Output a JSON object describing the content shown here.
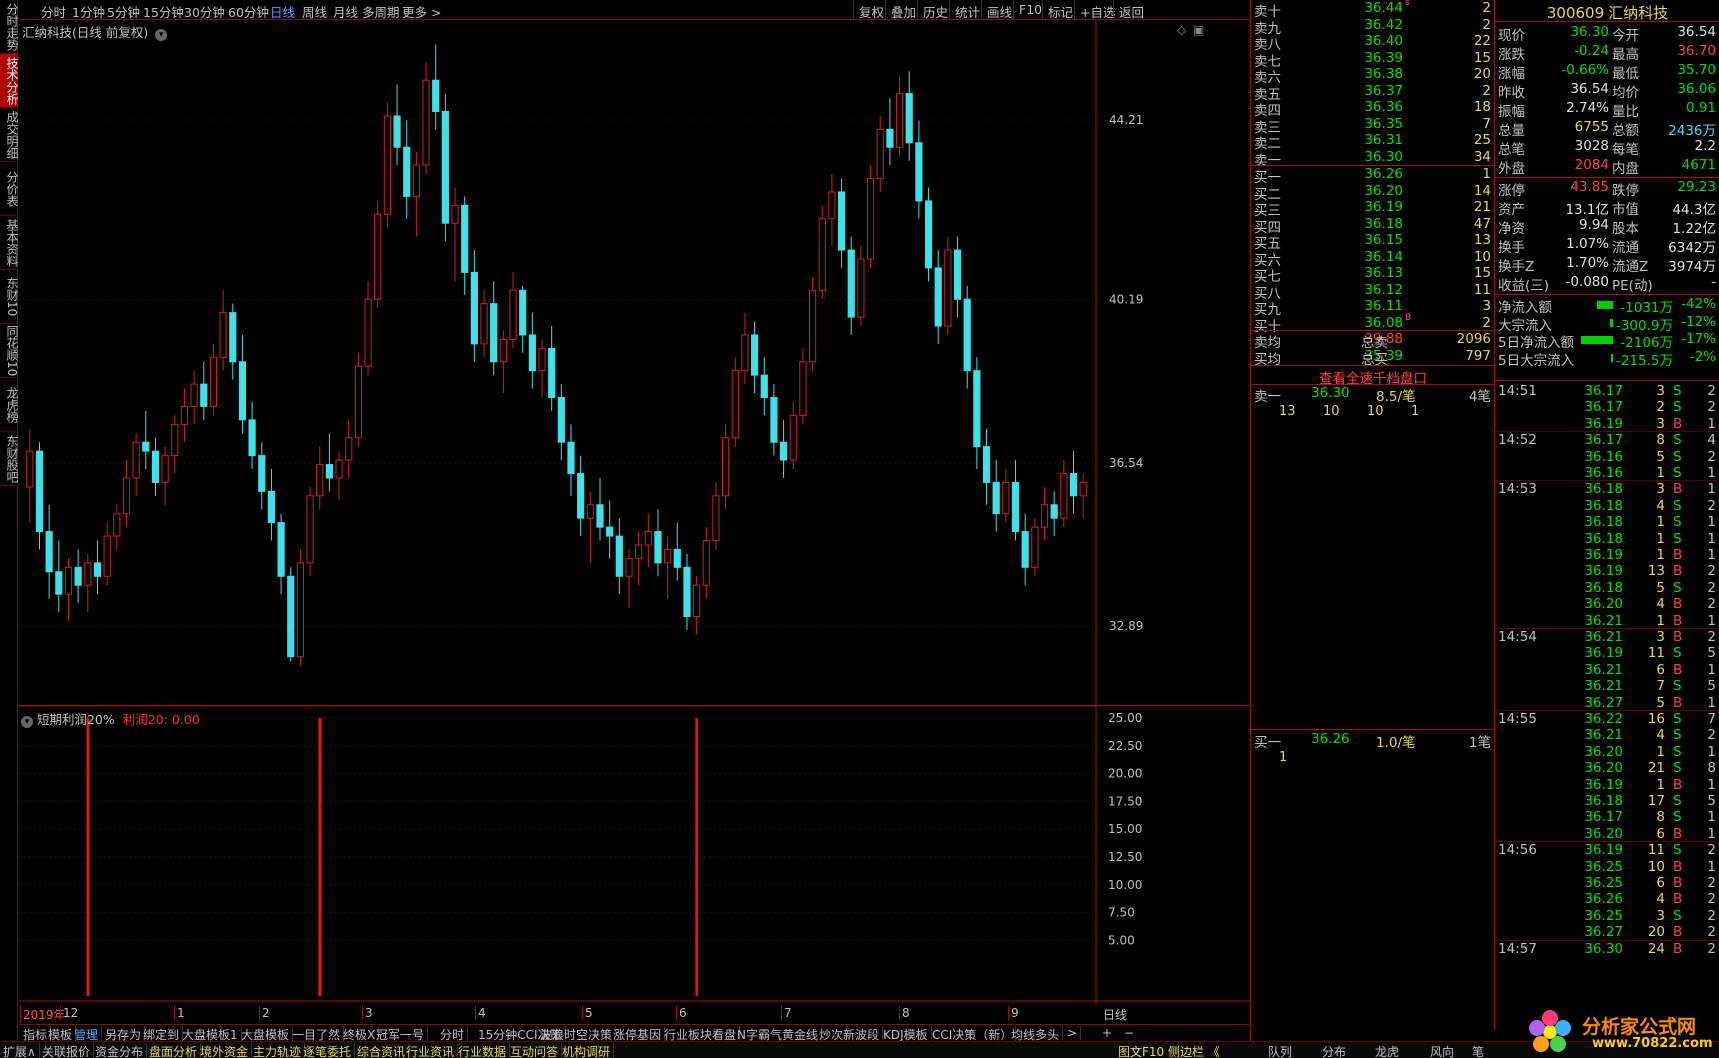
{
  "left_tabs": [
    "分时走势",
    "技术分析",
    "成交明细",
    "分价表",
    "基本资料",
    "东财10",
    "同花顺10",
    "龙虎榜",
    "东财股吧"
  ],
  "left_active": 1,
  "topbar": {
    "periods": [
      "分时",
      "1分钟",
      "5分钟",
      "15分钟",
      "30分钟",
      "60分钟",
      "日线",
      "周线",
      "月线",
      "多周期",
      "更多 >"
    ],
    "active_period": 6,
    "right_tools": [
      "复权",
      "叠加",
      "历史",
      "统计",
      "画线",
      "F10",
      "标记",
      "+自选",
      "返回"
    ]
  },
  "chart": {
    "title": "汇纳科技(日线 前复权)",
    "y_labels": [
      "44.21",
      "40.19",
      "36.54",
      "32.89"
    ],
    "x_labels": [
      "2019年",
      "12",
      "1",
      "2",
      "3",
      "4",
      "5",
      "6",
      "7",
      "8",
      "9"
    ],
    "period_label": "日线",
    "indicator_title": "短期利润20%",
    "indicator_value": "利润20: 0.00",
    "indicator_y_labels": [
      "25.00",
      "22.50",
      "20.00",
      "17.50",
      "15.00",
      "12.50",
      "10.00",
      "7.50",
      "5.00"
    ]
  },
  "chart_data": {
    "type": "candlestick",
    "title": "汇纳科技(日线 前复权)",
    "ylim": [
      31.5,
      46.0
    ],
    "y_ticks": [
      32.89,
      36.54,
      40.19,
      44.21
    ],
    "up_color": "#d02020",
    "down_color": "#40e0e8",
    "candles": [
      [
        36.0,
        37.3,
        35.2,
        36.8
      ],
      [
        36.8,
        37.0,
        34.6,
        35.0
      ],
      [
        35.0,
        35.6,
        33.5,
        34.1
      ],
      [
        34.1,
        34.8,
        33.2,
        33.6
      ],
      [
        33.6,
        34.4,
        33.0,
        34.2
      ],
      [
        34.2,
        34.6,
        33.4,
        33.8
      ],
      [
        33.8,
        34.5,
        33.2,
        34.3
      ],
      [
        34.3,
        34.8,
        33.6,
        34.0
      ],
      [
        34.0,
        35.2,
        33.8,
        34.9
      ],
      [
        34.9,
        35.6,
        34.6,
        35.4
      ],
      [
        35.4,
        36.6,
        35.1,
        36.2
      ],
      [
        36.2,
        37.2,
        35.8,
        37.0
      ],
      [
        37.0,
        37.7,
        36.4,
        36.8
      ],
      [
        36.8,
        37.1,
        35.8,
        36.1
      ],
      [
        36.1,
        36.9,
        35.6,
        36.7
      ],
      [
        36.7,
        37.6,
        36.3,
        37.4
      ],
      [
        37.4,
        38.2,
        37.0,
        37.8
      ],
      [
        37.8,
        38.6,
        37.4,
        38.3
      ],
      [
        38.3,
        38.8,
        37.5,
        37.8
      ],
      [
        37.8,
        39.2,
        37.6,
        38.9
      ],
      [
        38.9,
        40.4,
        38.6,
        39.9
      ],
      [
        39.9,
        40.1,
        38.4,
        38.8
      ],
      [
        38.8,
        39.4,
        37.2,
        37.5
      ],
      [
        37.5,
        37.9,
        36.4,
        36.7
      ],
      [
        36.7,
        37.0,
        35.5,
        35.9
      ],
      [
        35.9,
        36.4,
        34.8,
        35.2
      ],
      [
        35.2,
        35.4,
        33.6,
        34.0
      ],
      [
        34.0,
        34.2,
        32.1,
        32.2
      ],
      [
        32.2,
        34.6,
        32.0,
        34.3
      ],
      [
        34.3,
        36.0,
        34.0,
        35.8
      ],
      [
        35.8,
        36.9,
        35.5,
        36.5
      ],
      [
        36.5,
        37.2,
        35.9,
        36.2
      ],
      [
        36.2,
        36.8,
        35.7,
        36.6
      ],
      [
        36.6,
        37.5,
        36.2,
        37.1
      ],
      [
        37.1,
        39.0,
        36.9,
        38.7
      ],
      [
        38.7,
        40.6,
        38.5,
        40.2
      ],
      [
        40.2,
        42.4,
        40.0,
        42.1
      ],
      [
        42.1,
        44.6,
        41.8,
        44.3
      ],
      [
        44.3,
        45.0,
        43.2,
        43.6
      ],
      [
        43.6,
        44.2,
        42.0,
        42.5
      ],
      [
        42.5,
        43.5,
        41.6,
        43.2
      ],
      [
        43.2,
        45.5,
        43.0,
        45.1
      ],
      [
        45.1,
        45.9,
        44.0,
        44.4
      ],
      [
        44.4,
        44.8,
        41.5,
        41.9
      ],
      [
        41.9,
        42.7,
        40.6,
        42.3
      ],
      [
        42.3,
        42.5,
        40.3,
        40.8
      ],
      [
        40.8,
        41.3,
        38.8,
        39.2
      ],
      [
        39.2,
        40.4,
        38.9,
        40.1
      ],
      [
        40.1,
        40.6,
        38.5,
        38.8
      ],
      [
        38.8,
        39.5,
        38.1,
        39.3
      ],
      [
        39.3,
        40.8,
        39.1,
        40.4
      ],
      [
        40.4,
        40.5,
        39.0,
        39.4
      ],
      [
        39.4,
        39.9,
        38.2,
        38.6
      ],
      [
        38.6,
        39.3,
        38.0,
        39.1
      ],
      [
        39.1,
        39.6,
        37.7,
        38.0
      ],
      [
        38.0,
        38.3,
        36.6,
        37.0
      ],
      [
        37.0,
        37.4,
        35.8,
        36.3
      ],
      [
        36.3,
        36.7,
        34.9,
        35.3
      ],
      [
        35.3,
        35.9,
        34.3,
        35.6
      ],
      [
        35.6,
        36.2,
        34.8,
        35.1
      ],
      [
        35.1,
        35.7,
        34.4,
        34.9
      ],
      [
        34.9,
        35.3,
        33.6,
        34.0
      ],
      [
        34.0,
        34.6,
        33.3,
        34.4
      ],
      [
        34.4,
        35.0,
        33.8,
        34.7
      ],
      [
        34.7,
        35.4,
        34.2,
        35.0
      ],
      [
        35.0,
        35.5,
        34.0,
        34.3
      ],
      [
        34.3,
        34.9,
        33.5,
        34.6
      ],
      [
        34.6,
        35.2,
        33.9,
        34.2
      ],
      [
        34.2,
        34.5,
        32.8,
        33.1
      ],
      [
        33.1,
        34.0,
        32.7,
        33.8
      ],
      [
        33.8,
        35.1,
        33.5,
        34.8
      ],
      [
        34.8,
        36.1,
        34.6,
        35.8
      ],
      [
        35.8,
        37.4,
        35.5,
        37.1
      ],
      [
        37.1,
        38.9,
        36.9,
        38.6
      ],
      [
        38.6,
        39.9,
        38.3,
        39.4
      ],
      [
        39.4,
        39.7,
        38.1,
        38.5
      ],
      [
        38.5,
        38.9,
        37.6,
        38.0
      ],
      [
        38.0,
        38.3,
        36.7,
        37.0
      ],
      [
        37.0,
        37.5,
        36.2,
        36.6
      ],
      [
        36.6,
        37.9,
        36.4,
        37.6
      ],
      [
        37.6,
        39.1,
        37.4,
        38.8
      ],
      [
        38.8,
        40.7,
        38.6,
        40.4
      ],
      [
        40.4,
        42.3,
        40.2,
        42.0
      ],
      [
        42.0,
        43.0,
        41.4,
        42.6
      ],
      [
        42.6,
        42.9,
        40.9,
        41.3
      ],
      [
        41.3,
        41.6,
        39.4,
        39.8
      ],
      [
        39.8,
        41.4,
        39.6,
        41.1
      ],
      [
        41.1,
        43.2,
        40.9,
        42.9
      ],
      [
        42.9,
        44.3,
        42.6,
        44.0
      ],
      [
        44.0,
        44.7,
        43.2,
        43.6
      ],
      [
        43.6,
        45.2,
        43.4,
        44.8
      ],
      [
        44.8,
        45.3,
        43.3,
        43.7
      ],
      [
        43.7,
        44.2,
        42.0,
        42.4
      ],
      [
        42.4,
        42.7,
        40.6,
        40.9
      ],
      [
        40.9,
        41.3,
        39.2,
        39.6
      ],
      [
        39.6,
        41.6,
        39.4,
        41.3
      ],
      [
        41.3,
        41.6,
        39.8,
        40.2
      ],
      [
        40.2,
        40.5,
        38.2,
        38.6
      ],
      [
        38.6,
        38.9,
        36.4,
        36.9
      ],
      [
        36.9,
        37.3,
        35.6,
        36.1
      ],
      [
        36.1,
        36.6,
        35.0,
        35.4
      ],
      [
        35.4,
        36.4,
        35.2,
        36.1
      ],
      [
        36.1,
        36.6,
        34.8,
        35.0
      ],
      [
        35.0,
        35.4,
        33.8,
        34.2
      ],
      [
        34.2,
        35.3,
        34.0,
        35.1
      ],
      [
        35.1,
        36.0,
        34.8,
        35.6
      ],
      [
        35.6,
        35.9,
        34.9,
        35.3
      ],
      [
        35.3,
        36.6,
        35.1,
        36.3
      ],
      [
        36.3,
        36.8,
        35.4,
        35.8
      ],
      [
        35.8,
        36.3,
        35.3,
        36.1
      ]
    ],
    "indicator": {
      "name": "短期利润20%",
      "ylim": [
        0,
        25
      ],
      "y_ticks": [
        5,
        7.5,
        10,
        12.5,
        15,
        17.5,
        20,
        22.5,
        25
      ],
      "signals_at_index": [
        6,
        30,
        69
      ]
    }
  },
  "tabbar1": [
    "指标",
    "模板",
    "管理",
    "另存为",
    "绑定到",
    "大盘模板1",
    "大盘模板",
    "一目了然",
    "终极X",
    "冠军一号",
    "分时",
    "15分钟CCI决策",
    "波浪时空决策",
    "涨停基因",
    "行业板块看盘",
    "N字霸气黄金线",
    "炒次新波段",
    "KDJ模板",
    "CCI决策（新）",
    "均线多头",
    ">"
  ],
  "tabbar1_active": 2,
  "tabbar1_right": [
    "+",
    "−"
  ],
  "tabbar2": [
    "扩展∧",
    "关联报价",
    "资金分布",
    "盘面分析",
    "境外资金",
    "主力轨迹",
    "逐笔委托",
    "综合资讯",
    "行业资讯",
    "行业数据",
    "互动问答",
    "机构调研"
  ],
  "tabbar2_right": "图文F10 侧边栏 《",
  "stock": {
    "code": "300609",
    "name": "汇纳科技"
  },
  "asks": [
    {
      "label": "卖十",
      "price": "36.44",
      "vol": "2",
      "mark": "s"
    },
    {
      "label": "卖九",
      "price": "36.42",
      "vol": "2"
    },
    {
      "label": "卖八",
      "price": "36.40",
      "vol": "22"
    },
    {
      "label": "卖七",
      "price": "36.39",
      "vol": "15"
    },
    {
      "label": "卖六",
      "price": "36.38",
      "vol": "20"
    },
    {
      "label": "卖五",
      "price": "36.37",
      "vol": "2"
    },
    {
      "label": "卖四",
      "price": "36.36",
      "vol": "18"
    },
    {
      "label": "卖三",
      "price": "36.35",
      "vol": "7"
    },
    {
      "label": "卖二",
      "price": "36.31",
      "vol": "25"
    },
    {
      "label": "卖一",
      "price": "36.30",
      "vol": "34"
    }
  ],
  "bids": [
    {
      "label": "买一",
      "price": "36.26",
      "vol": "1"
    },
    {
      "label": "买二",
      "price": "36.20",
      "vol": "14"
    },
    {
      "label": "买三",
      "price": "36.19",
      "vol": "21"
    },
    {
      "label": "买四",
      "price": "36.18",
      "vol": "47"
    },
    {
      "label": "买五",
      "price": "36.15",
      "vol": "13"
    },
    {
      "label": "买六",
      "price": "36.14",
      "vol": "10"
    },
    {
      "label": "买七",
      "price": "36.13",
      "vol": "15"
    },
    {
      "label": "买八",
      "price": "36.12",
      "vol": "11"
    },
    {
      "label": "买九",
      "price": "36.11",
      "vol": "3"
    },
    {
      "label": "买十",
      "price": "36.08",
      "vol": "2",
      "mark": "B"
    }
  ],
  "avg": {
    "sell_avg_label": "卖均",
    "sell_avg": "39.88",
    "total_sell_label": "总卖",
    "total_sell": "2096",
    "buy_avg_label": "买均",
    "buy_avg": "35.39",
    "total_buy_label": "总买",
    "total_buy": "797"
  },
  "view_full_depth": "查看全速千档盘口",
  "queue_sell": {
    "label": "卖一",
    "price": "36.30",
    "per": "8.5/笔",
    "count": "4笔",
    "orders": [
      "13",
      "10",
      "10",
      "1"
    ]
  },
  "queue_buy": {
    "label": "买一",
    "price": "36.26",
    "per": "1.0/笔",
    "count": "1笔",
    "orders": [
      "1"
    ]
  },
  "info": [
    {
      "k1": "现价",
      "v1": "36.30",
      "c1": "dn",
      "k2": "今开",
      "v2": "36.54",
      "c2": "wh"
    },
    {
      "k1": "涨跌",
      "v1": "-0.24",
      "c1": "dn",
      "k2": "最高",
      "v2": "36.70",
      "c2": "up"
    },
    {
      "k1": "涨幅",
      "v1": "-0.66%",
      "c1": "dn",
      "k2": "最低",
      "v2": "35.70",
      "c2": "dn"
    },
    {
      "k1": "昨收",
      "v1": "36.54",
      "c1": "wh",
      "k2": "均价",
      "v2": "36.06",
      "c2": "dn"
    },
    {
      "k1": "振幅",
      "v1": "2.74%",
      "c1": "wh",
      "k2": "量比",
      "v2": "0.91",
      "c2": "dn"
    },
    {
      "k1": "总量",
      "v1": "6755",
      "c1": "yl",
      "k2": "总额",
      "v2": "2436万",
      "c2": "cy"
    },
    {
      "k1": "总笔",
      "v1": "3028",
      "c1": "wh",
      "k2": "每笔",
      "v2": "2.2",
      "c2": "wh"
    },
    {
      "k1": "外盘",
      "v1": "2084",
      "c1": "up",
      "k2": "内盘",
      "v2": "4671",
      "c2": "dn"
    },
    {
      "k1": "涨停",
      "v1": "43.85",
      "c1": "up",
      "k2": "跌停",
      "v2": "29.23",
      "c2": "dn"
    },
    {
      "k1": "资产",
      "v1": "13.1亿",
      "c1": "wh",
      "k2": "市值",
      "v2": "44.3亿",
      "c2": "wh"
    },
    {
      "k1": "净资",
      "v1": "9.94",
      "c1": "wh",
      "k2": "股本",
      "v2": "1.22亿",
      "c2": "wh"
    },
    {
      "k1": "换手",
      "v1": "1.07%",
      "c1": "wh",
      "k2": "流通",
      "v2": "6342万",
      "c2": "wh"
    },
    {
      "k1": "换手Z",
      "v1": "1.70%",
      "c1": "wh",
      "k2": "流通Z",
      "v2": "3974万",
      "c2": "wh"
    },
    {
      "k1": "收益(三)",
      "v1": "-0.080",
      "c1": "wh",
      "k2": "PE(动)",
      "v2": "-",
      "c2": "wh"
    }
  ],
  "flows": [
    {
      "k": "净流入额",
      "v": "-1031万",
      "p": "-42%",
      "bar": 0.5
    },
    {
      "k": "大宗流入",
      "v": "-300.9万",
      "p": "-12%",
      "bar": 0.1
    },
    {
      "k": "5日净流入额",
      "v": "-2106万",
      "p": "-17%",
      "bar": 1.0
    },
    {
      "k": "5日大宗流入",
      "v": "-215.5万",
      "p": "-2%",
      "bar": 0.05
    }
  ],
  "ticks": [
    {
      "t": "14:51",
      "p": "36.17",
      "v": "3",
      "bs": "S",
      "n": "2"
    },
    {
      "t": "",
      "p": "36.17",
      "v": "2",
      "bs": "S",
      "n": "2"
    },
    {
      "t": "",
      "p": "36.19",
      "v": "3",
      "bs": "B",
      "n": "1"
    },
    {
      "t": "14:52",
      "p": "36.17",
      "v": "8",
      "bs": "S",
      "n": "4"
    },
    {
      "t": "",
      "p": "36.16",
      "v": "5",
      "bs": "S",
      "n": "2"
    },
    {
      "t": "",
      "p": "36.16",
      "v": "1",
      "bs": "S",
      "n": "1"
    },
    {
      "t": "14:53",
      "p": "36.18",
      "v": "3",
      "bs": "B",
      "n": "1"
    },
    {
      "t": "",
      "p": "36.18",
      "v": "4",
      "bs": "S",
      "n": "2"
    },
    {
      "t": "",
      "p": "36.18",
      "v": "1",
      "bs": "S",
      "n": "1"
    },
    {
      "t": "",
      "p": "36.18",
      "v": "1",
      "bs": "S",
      "n": "1"
    },
    {
      "t": "",
      "p": "36.19",
      "v": "1",
      "bs": "B",
      "n": "1"
    },
    {
      "t": "",
      "p": "36.19",
      "v": "13",
      "bs": "B",
      "n": "2"
    },
    {
      "t": "",
      "p": "36.18",
      "v": "5",
      "bs": "S",
      "n": "2"
    },
    {
      "t": "",
      "p": "36.20",
      "v": "4",
      "bs": "B",
      "n": "2"
    },
    {
      "t": "",
      "p": "36.21",
      "v": "1",
      "bs": "B",
      "n": "1"
    },
    {
      "t": "14:54",
      "p": "36.21",
      "v": "3",
      "bs": "B",
      "n": "2"
    },
    {
      "t": "",
      "p": "36.19",
      "v": "11",
      "bs": "S",
      "n": "5"
    },
    {
      "t": "",
      "p": "36.21",
      "v": "6",
      "bs": "B",
      "n": "1"
    },
    {
      "t": "",
      "p": "36.21",
      "v": "7",
      "bs": "S",
      "n": "5"
    },
    {
      "t": "",
      "p": "36.27",
      "v": "5",
      "bs": "B",
      "n": "1"
    },
    {
      "t": "14:55",
      "p": "36.22",
      "v": "16",
      "bs": "S",
      "n": "7"
    },
    {
      "t": "",
      "p": "36.21",
      "v": "4",
      "bs": "S",
      "n": "2"
    },
    {
      "t": "",
      "p": "36.20",
      "v": "1",
      "bs": "S",
      "n": "1"
    },
    {
      "t": "",
      "p": "36.20",
      "v": "21",
      "bs": "S",
      "n": "8"
    },
    {
      "t": "",
      "p": "36.19",
      "v": "1",
      "bs": "B",
      "n": "1"
    },
    {
      "t": "",
      "p": "36.18",
      "v": "17",
      "bs": "S",
      "n": "5"
    },
    {
      "t": "",
      "p": "36.17",
      "v": "8",
      "bs": "S",
      "n": "1"
    },
    {
      "t": "",
      "p": "36.20",
      "v": "6",
      "bs": "B",
      "n": "1"
    },
    {
      "t": "14:56",
      "p": "36.19",
      "v": "11",
      "bs": "S",
      "n": "2"
    },
    {
      "t": "",
      "p": "36.25",
      "v": "10",
      "bs": "B",
      "n": "1"
    },
    {
      "t": "",
      "p": "36.25",
      "v": "6",
      "bs": "B",
      "n": "2"
    },
    {
      "t": "",
      "p": "36.26",
      "v": "4",
      "bs": "B",
      "n": "2"
    },
    {
      "t": "",
      "p": "36.25",
      "v": "3",
      "bs": "S",
      "n": "2"
    },
    {
      "t": "",
      "p": "36.27",
      "v": "20",
      "bs": "B",
      "n": "2"
    },
    {
      "t": "14:57",
      "p": "36.30",
      "v": "24",
      "bs": "B",
      "n": "2"
    }
  ],
  "bottom_tabs": [
    "队列",
    "分布",
    "龙虎",
    "风向",
    "笔"
  ],
  "watermark": {
    "text": "分析家公式网",
    "url": "www.70822.com"
  },
  "colors": {
    "up": "#ff4040",
    "down": "#00e000",
    "candle_up": "#d02020",
    "candle_down": "#40e0e8",
    "volume": "#e8d84a",
    "border": "#a01010",
    "accent": "#4aa3ff"
  }
}
